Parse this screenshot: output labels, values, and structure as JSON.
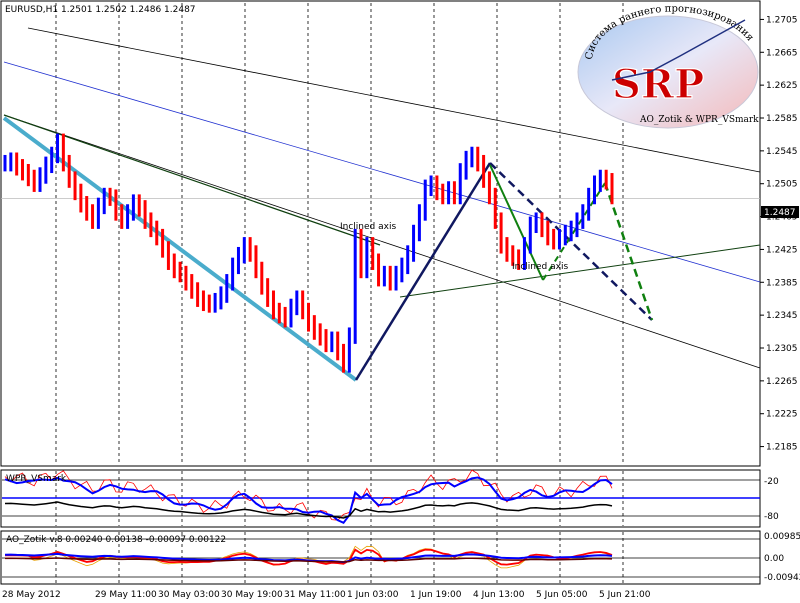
{
  "chart_data": {
    "type": "candlestick",
    "symbol_header": "EURUSD,H1  1.2501 1.2502 1.2486 1.2487",
    "current_price": "1.2487",
    "y_ticks": [
      "1.2705",
      "1.2665",
      "1.2625",
      "1.2585",
      "1.2545",
      "1.2505",
      "1.2465",
      "1.2425",
      "1.2385",
      "1.2345",
      "1.2305",
      "1.2265",
      "1.2225",
      "1.2185"
    ],
    "ylim": [
      1.2165,
      1.2725
    ],
    "x_ticks": [
      "28 May 2012",
      "29 May 11:00",
      "30 May 03:00",
      "30 May 19:00",
      "31 May 11:00",
      "1 Jun 03:00",
      "1 Jun 19:00",
      "4 Jun 13:00",
      "5 Jun 05:00",
      "5 Jun 21:00"
    ],
    "closes": [
      1.253,
      1.2533,
      1.2525,
      1.2519,
      1.2512,
      1.2505,
      1.2515,
      1.2528,
      1.254,
      1.2556,
      1.253,
      1.251,
      1.2495,
      1.248,
      1.247,
      1.246,
      1.2478,
      1.249,
      1.2488,
      1.247,
      1.246,
      1.247,
      1.2482,
      1.2475,
      1.246,
      1.245,
      1.244,
      1.2425,
      1.241,
      1.24,
      1.2395,
      1.2385,
      1.2375,
      1.2365,
      1.236,
      1.2358,
      1.2362,
      1.237,
      1.2385,
      1.2405,
      1.2418,
      1.243,
      1.242,
      1.24,
      1.238,
      1.2365,
      1.235,
      1.2345,
      1.234,
      1.2355,
      1.2365,
      1.235,
      1.2335,
      1.2325,
      1.2318,
      1.231,
      1.2315,
      1.23,
      1.2285,
      1.232,
      1.244,
      1.24,
      1.243,
      1.241,
      1.239,
      1.2395,
      1.2385,
      1.2395,
      1.2405,
      1.242,
      1.2445,
      1.247,
      1.25,
      1.2505,
      1.2495,
      1.249,
      1.2498,
      1.249,
      1.252,
      1.2535,
      1.254,
      1.253,
      1.251,
      1.249,
      1.246,
      1.243,
      1.242,
      1.2415,
      1.241,
      1.243,
      1.2455,
      1.246,
      1.245,
      1.244,
      1.2435,
      1.244,
      1.2445,
      1.245,
      1.246,
      1.247,
      1.249,
      1.2505,
      1.2512,
      1.2508,
      1.249
    ],
    "annotations": [
      "Inclined axis",
      "Inclined axis"
    ],
    "indicators": [
      {
        "name": "WPR_VSmark",
        "levels": [
          "-20",
          "-80"
        ]
      },
      {
        "name": "AO_Zotik v.8 0.00240 0.00138 -0.00097 0.00122",
        "levels": [
          "0.00985",
          "0.00",
          "-0.00942"
        ]
      }
    ]
  },
  "logo": {
    "monogram": "SRP",
    "arc_text": "Система раннего прогнозирования",
    "footer_text": "AO_Zotik & WPR_VSmark"
  },
  "colors": {
    "bull": "#0000ff",
    "bear": "#ff0000",
    "trend_cyan": "#4aaccc",
    "channel_blue": "#2030d0",
    "navy": "#101860",
    "green": "#108010",
    "dkgreen": "#104010"
  }
}
